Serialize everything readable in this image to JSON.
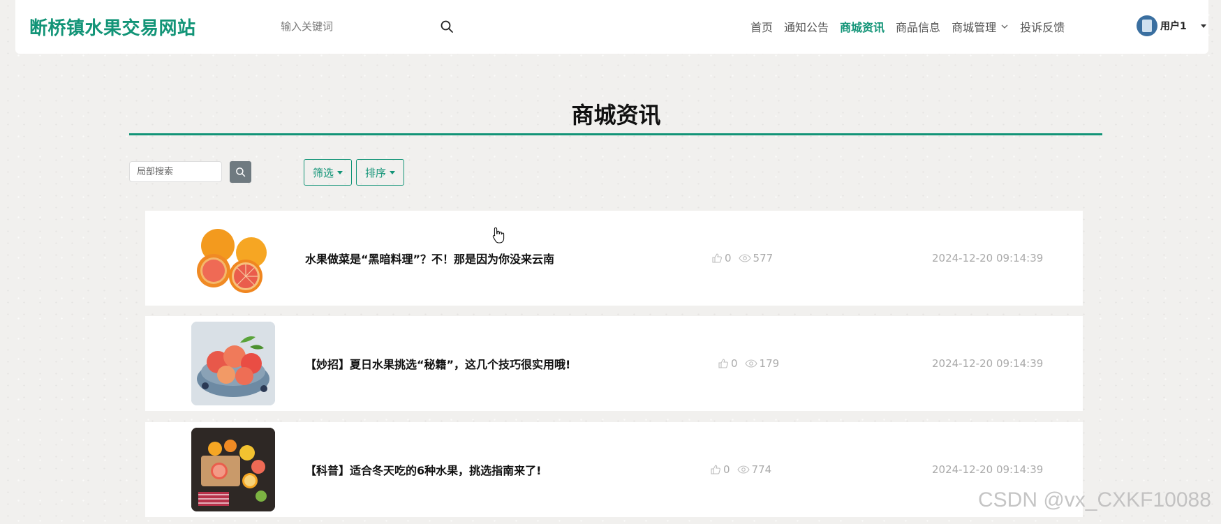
{
  "header": {
    "brand": "断桥镇水果交易网站",
    "search_placeholder": "输入关键词",
    "nav": [
      {
        "label": "首页"
      },
      {
        "label": "通知公告"
      },
      {
        "label": "商城资讯"
      },
      {
        "label": "商品信息"
      },
      {
        "label": "商城管理"
      },
      {
        "label": "投诉反馈"
      }
    ],
    "active_nav": "商城资讯",
    "user_name": "用户1"
  },
  "page": {
    "title": "商城资讯",
    "local_search_placeholder": "局部搜索",
    "filter_label": "筛选",
    "sort_label": "排序"
  },
  "colors": {
    "accent": "#129477",
    "muted": "#aaaaaa"
  },
  "news": [
    {
      "title": "水果做菜是“黑暗料理”？不！那是因为你没来云南",
      "likes": "0",
      "views": "577",
      "date": "2024-12-20 09:14:39",
      "image": "grapefruit"
    },
    {
      "title": "【妙招】夏日水果挑选“秘籍”，这几个技巧很实用哦!",
      "likes": "0",
      "views": "179",
      "date": "2024-12-20 09:14:39",
      "image": "peaches-basket"
    },
    {
      "title": "【科普】适合冬天吃的6种水果，挑选指南来了!",
      "likes": "0",
      "views": "774",
      "date": "2024-12-20 09:14:39",
      "image": "citrus-board"
    }
  ],
  "watermark": "CSDN @vx_CXKF10088"
}
